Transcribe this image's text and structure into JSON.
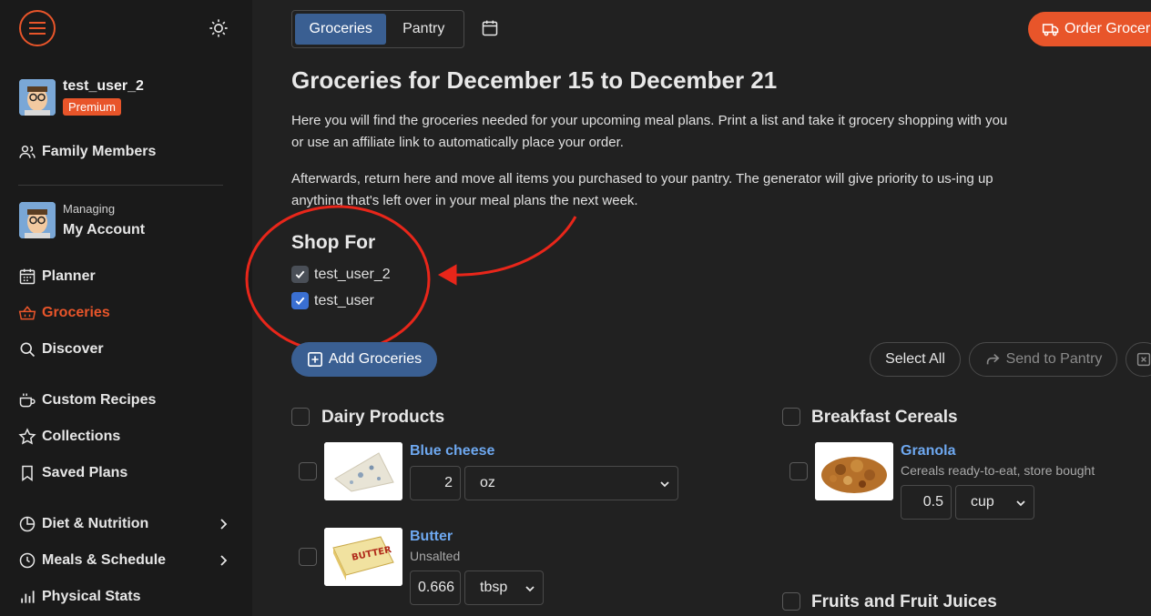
{
  "sidebar": {
    "user": {
      "name": "test_user_2",
      "badge": "Premium"
    },
    "family_members": "Family Members",
    "managing": {
      "label": "Managing",
      "account": "My Account"
    },
    "items": [
      {
        "label": "Planner"
      },
      {
        "label": "Groceries"
      },
      {
        "label": "Discover"
      },
      {
        "label": "Custom Recipes"
      },
      {
        "label": "Collections"
      },
      {
        "label": "Saved Plans"
      },
      {
        "label": "Diet & Nutrition"
      },
      {
        "label": "Meals & Schedule"
      },
      {
        "label": "Physical Stats"
      }
    ]
  },
  "header": {
    "tabs": [
      {
        "label": "Groceries",
        "active": true
      },
      {
        "label": "Pantry",
        "active": false
      }
    ],
    "order_button": "Order Grocer"
  },
  "main": {
    "title": "Groceries for December 15 to December 21",
    "para1": "Here you will find the groceries needed for your upcoming meal plans. Print a list and take it grocery shopping with you or use an affiliate link to automatically place your order.",
    "para2": "Afterwards, return here and move all items you purchased to your pantry. The generator will give priority to us-ing up anything that's left over in your meal plans the next week.",
    "shop_for": {
      "heading": "Shop For",
      "users": [
        {
          "name": "test_user_2",
          "checked": true
        },
        {
          "name": "test_user",
          "checked": true
        }
      ]
    },
    "actions": {
      "add_groceries": "Add Groceries",
      "select_all": "Select All",
      "send_to_pantry": "Send to Pantry"
    },
    "categories": [
      {
        "name": "Dairy Products",
        "items": [
          {
            "name": "Blue cheese",
            "subtitle": "",
            "qty": "2",
            "unit": "oz"
          },
          {
            "name": "Butter",
            "subtitle": "Unsalted",
            "qty": "0.666",
            "unit": "tbsp"
          }
        ]
      },
      {
        "name": "Breakfast Cereals",
        "items": [
          {
            "name": "Granola",
            "subtitle": "Cereals ready-to-eat, store bought",
            "qty": "0.5",
            "unit": "cup"
          }
        ]
      },
      {
        "name": "Fruits and Fruit Juices",
        "items": []
      }
    ]
  },
  "colors": {
    "accent": "#e8552a",
    "primary": "#3a5f92",
    "link": "#6ea8f0",
    "background": "#212121",
    "sidebar": "#1a1a1a"
  },
  "icons": [
    "menu-icon",
    "sun-icon",
    "users-icon",
    "calendar-grid-icon",
    "basket-icon",
    "search-icon",
    "cup-icon",
    "star-icon",
    "bookmark-icon",
    "pie-chart-icon",
    "clock-icon",
    "bar-chart-icon",
    "chevron-right-icon",
    "calendar-icon",
    "truck-icon",
    "plus-square-icon",
    "forward-icon",
    "check-icon"
  ]
}
